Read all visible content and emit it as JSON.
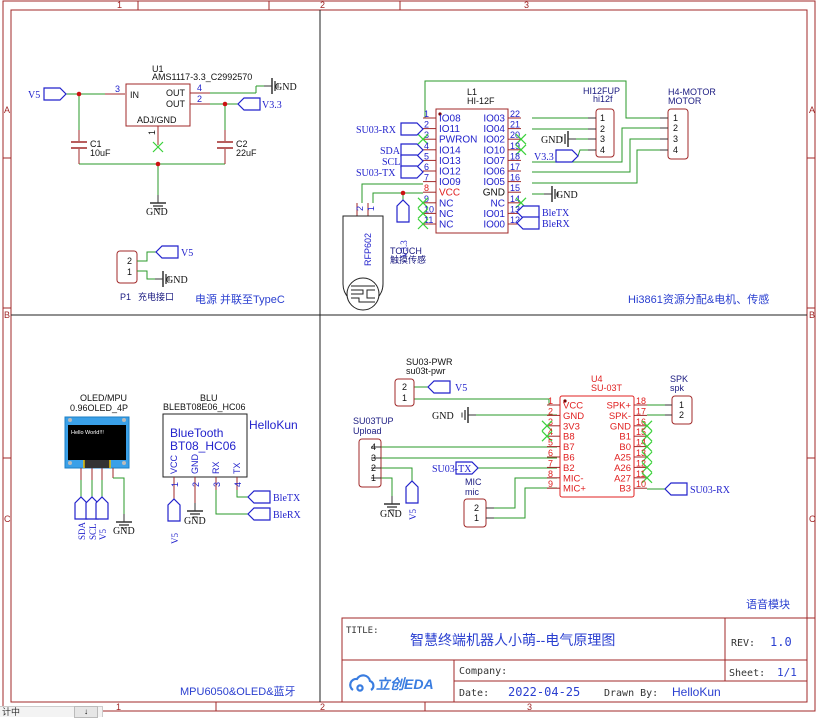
{
  "frame": {
    "columns": [
      "1",
      "2",
      "3"
    ],
    "rows": [
      "A",
      "B",
      "C"
    ],
    "colors": {
      "frame": "#a02828",
      "wire": "#2a9a2a",
      "net": "#2222cc",
      "pin": "#a02828",
      "text": "#1a1a1a",
      "title_blue": "#2a3fd0",
      "ic_red": "#e02020",
      "nc_cross": "#3ad13a"
    }
  },
  "power_block": {
    "caption": "电源 并联至TypeC",
    "regulator": {
      "ref": "U1",
      "value": "AMS1117-3.3_C2992570",
      "pins": [
        {
          "num": "3",
          "name": "IN"
        },
        {
          "num": "4",
          "name": "OUT"
        },
        {
          "num": "2",
          "name": "OUT"
        },
        {
          "num": "1",
          "name": "ADJ/GND"
        }
      ]
    },
    "c1": {
      "ref": "C1",
      "value": "10uF"
    },
    "c2": {
      "ref": "C2",
      "value": "22uF"
    },
    "nets": {
      "v5": "V5",
      "v33": "V3.3",
      "gnd": "GND"
    },
    "p1": {
      "ref": "P1",
      "label": "充电接口",
      "pins": [
        "2",
        "1"
      ],
      "nets": [
        "V5",
        "GND"
      ]
    }
  },
  "hi3861_block": {
    "caption": "Hi3861资源分配&电机、传感",
    "module": {
      "ref": "L1",
      "value": "HI-12F",
      "left_pins": [
        {
          "num": "1",
          "name": "IO08"
        },
        {
          "num": "2",
          "name": "IO11"
        },
        {
          "num": "3",
          "name": "PWRON"
        },
        {
          "num": "4",
          "name": "IO14"
        },
        {
          "num": "5",
          "name": "IO13"
        },
        {
          "num": "6",
          "name": "IO12"
        },
        {
          "num": "7",
          "name": "IO09"
        },
        {
          "num": "8",
          "name": "VCC"
        },
        {
          "num": "9",
          "name": "NC"
        },
        {
          "num": "10",
          "name": "NC"
        },
        {
          "num": "11",
          "name": "NC"
        }
      ],
      "right_pins": [
        {
          "num": "22",
          "name": "IO03"
        },
        {
          "num": "21",
          "name": "IO04"
        },
        {
          "num": "20",
          "name": "IO02"
        },
        {
          "num": "19",
          "name": "IO10"
        },
        {
          "num": "18",
          "name": "IO07"
        },
        {
          "num": "17",
          "name": "IO06"
        },
        {
          "num": "16",
          "name": "IO05"
        },
        {
          "num": "15",
          "name": "GND"
        },
        {
          "num": "14",
          "name": "NC"
        },
        {
          "num": "13",
          "name": "IO01"
        },
        {
          "num": "12",
          "name": "IO00"
        }
      ]
    },
    "left_nets": [
      "SU03-RX",
      "SDA",
      "SCL",
      "SU03-TX"
    ],
    "right_nets": [
      "GND",
      "BleTX",
      "BleRX"
    ],
    "vcc_net": "V3.3",
    "hi12fup": {
      "ref": "HI12FUP",
      "value": "hi12f",
      "pins": [
        "1",
        "2",
        "3",
        "4"
      ],
      "gnd": "GND",
      "v33": "V3.3"
    },
    "motor": {
      "ref": "H4-MOTOR",
      "value": "MOTOR",
      "pins": [
        "1",
        "2",
        "3",
        "4"
      ]
    },
    "touch": {
      "ref": "RFP602",
      "label1": "TOUCH",
      "label2": "触摸传感",
      "pins": [
        "2",
        "1"
      ]
    }
  },
  "oled_block": {
    "caption": "MPU6050&OLED&蓝牙",
    "oled": {
      "ref": "OLED/MPU",
      "value": "0.96OLED_4P",
      "screen_text": "Hello World!!!",
      "nets": [
        "SDA",
        "SCL",
        "V5"
      ],
      "gnd": "GND"
    },
    "bt": {
      "ref": "BLU",
      "value": "BLEBT08E06_HC06",
      "name1": "BlueTooth",
      "name2": "BT08_HC06",
      "author": "HelloKun",
      "pins": [
        {
          "num": "1",
          "name": "VCC"
        },
        {
          "num": "2",
          "name": "GND"
        },
        {
          "num": "3",
          "name": "RX"
        },
        {
          "num": "4",
          "name": "TX"
        }
      ],
      "nets": {
        "vcc": "V5",
        "gnd": "GND",
        "tx": "BleTX",
        "rx": "BleRX"
      }
    }
  },
  "voice_block": {
    "caption": "语音模块",
    "pwr": {
      "ref": "SU03-PWR",
      "value": "su03t-pwr",
      "pins": [
        "2",
        "1"
      ],
      "net": "V5"
    },
    "upload": {
      "ref": "SU03TUP",
      "value": "Upload",
      "pins": [
        "4",
        "3",
        "2",
        "1"
      ],
      "gnd": "GND",
      "v5": "V5"
    },
    "gnd": "GND",
    "tx_net": "SU03-TX",
    "mic": {
      "ref": "MIC",
      "value": "mic",
      "pins": [
        "2",
        "1"
      ]
    },
    "module": {
      "ref": "U4",
      "value": "SU-03T",
      "left_pins": [
        {
          "num": "1",
          "name": "VCC"
        },
        {
          "num": "2",
          "name": "GND"
        },
        {
          "num": "3",
          "name": "3V3"
        },
        {
          "num": "4",
          "name": "B8"
        },
        {
          "num": "5",
          "name": "B7"
        },
        {
          "num": "6",
          "name": "B6"
        },
        {
          "num": "7",
          "name": "B2"
        },
        {
          "num": "8",
          "name": "MIC-"
        },
        {
          "num": "9",
          "name": "MIC+"
        }
      ],
      "right_pins": [
        {
          "num": "18",
          "name": "SPK+"
        },
        {
          "num": "17",
          "name": "SPK-"
        },
        {
          "num": "16",
          "name": "GND"
        },
        {
          "num": "15",
          "name": "B1"
        },
        {
          "num": "14",
          "name": "B0"
        },
        {
          "num": "13",
          "name": "A25"
        },
        {
          "num": "12",
          "name": "A26"
        },
        {
          "num": "11",
          "name": "A27"
        },
        {
          "num": "10",
          "name": "B3"
        }
      ]
    },
    "spk": {
      "ref": "SPK",
      "value": "spk",
      "pins": [
        "1",
        "2"
      ]
    },
    "rx_net": "SU03-RX"
  },
  "title_block": {
    "title_label": "TITLE:",
    "title": "智慧终端机器人小萌--电气原理图",
    "rev_label": "REV:",
    "rev": "1.0",
    "company_label": "Company:",
    "company": "",
    "sheet_label": "Sheet:",
    "sheet": "1/1",
    "date_label": "Date:",
    "date": "2022-04-25",
    "drawn_label": "Drawn By:",
    "drawn_by": "HelloKun",
    "logo": "立创EDA"
  },
  "taskbar": {
    "fragment": "计中",
    "button": "↓"
  }
}
